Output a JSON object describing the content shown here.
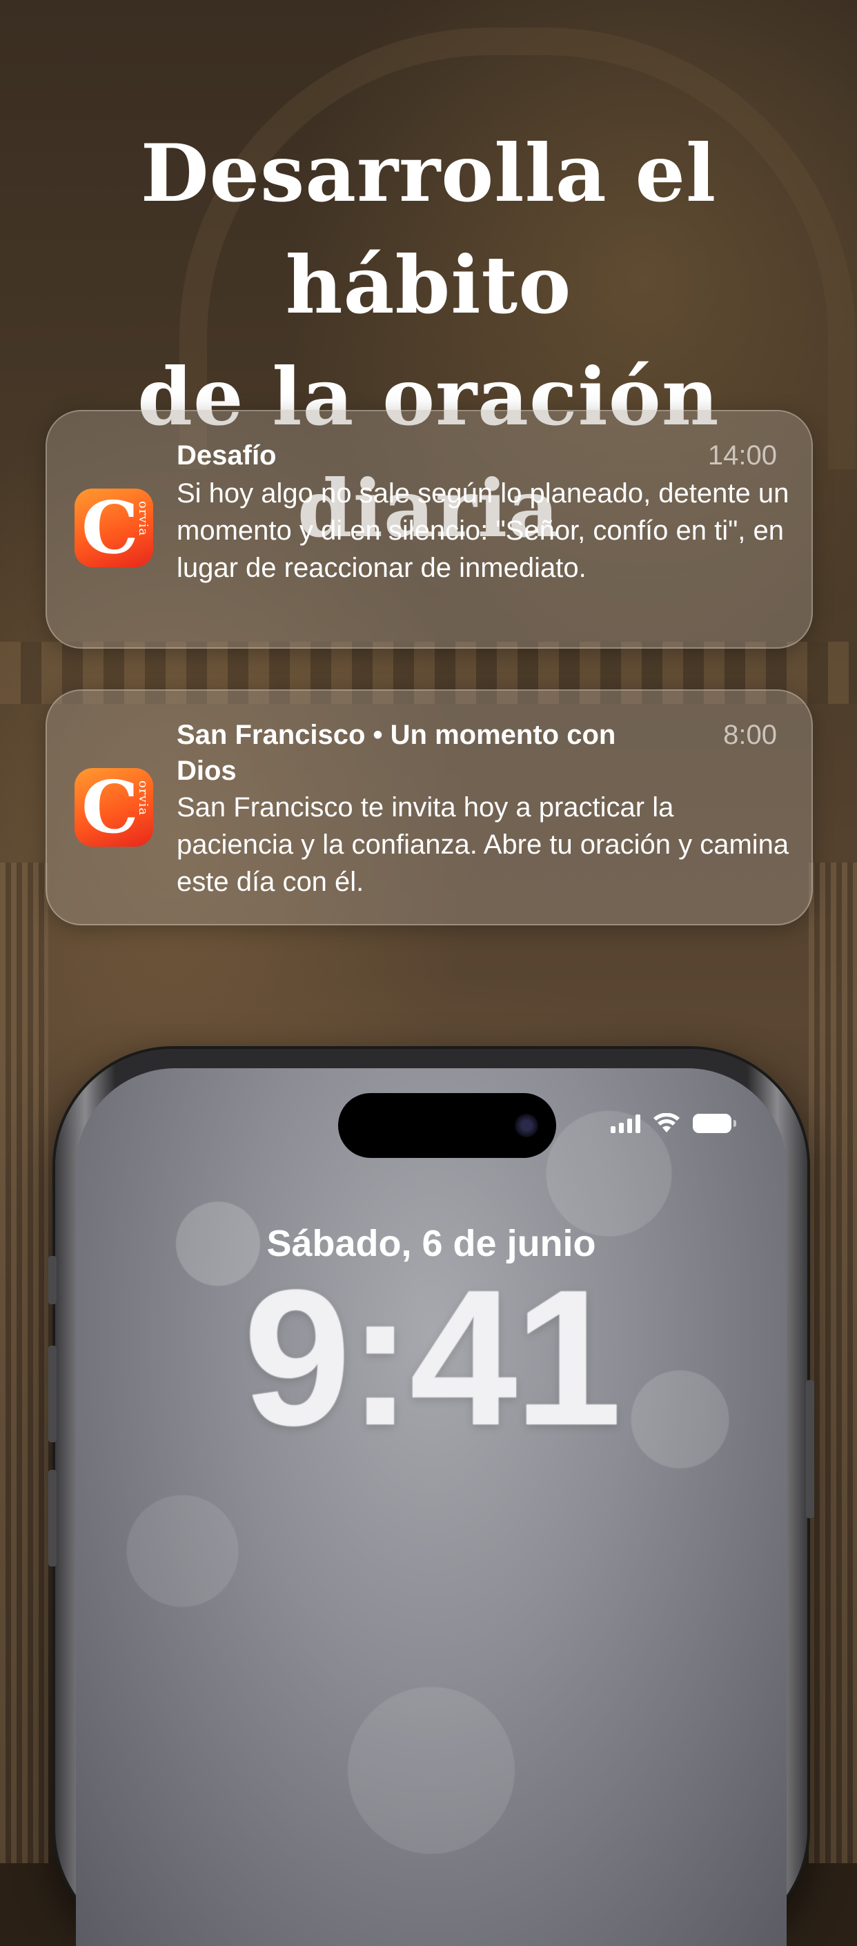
{
  "headline": {
    "line1": "Desarrolla el hábito",
    "line2": "de la oración diaria"
  },
  "notifications": [
    {
      "app_icon": "corvia-app-icon",
      "icon_letter": "C",
      "icon_sub": "orvia",
      "title": "Desafío",
      "time": "14:00",
      "body": "Si hoy algo no sale según lo planeado, detente un momento y di en silencio: \"Señor, confío en ti\", en lugar de reaccionar de inmediato."
    },
    {
      "app_icon": "corvia-app-icon",
      "icon_letter": "C",
      "icon_sub": "orvia",
      "title": "San Francisco • Un momento con Dios",
      "time": "8:00",
      "body": "San Francisco te invita hoy a practicar la paciencia y la confianza. Abre tu oración y camina este día con él."
    }
  ],
  "lockscreen": {
    "date": "Sábado, 6 de junio",
    "time": "9:41",
    "status_icons": [
      "signal-icon",
      "wifi-icon",
      "battery-icon"
    ]
  },
  "colors": {
    "icon_gradient_top": "#ff9a30",
    "icon_gradient_bottom": "#e8281c",
    "text": "#ffffff"
  }
}
